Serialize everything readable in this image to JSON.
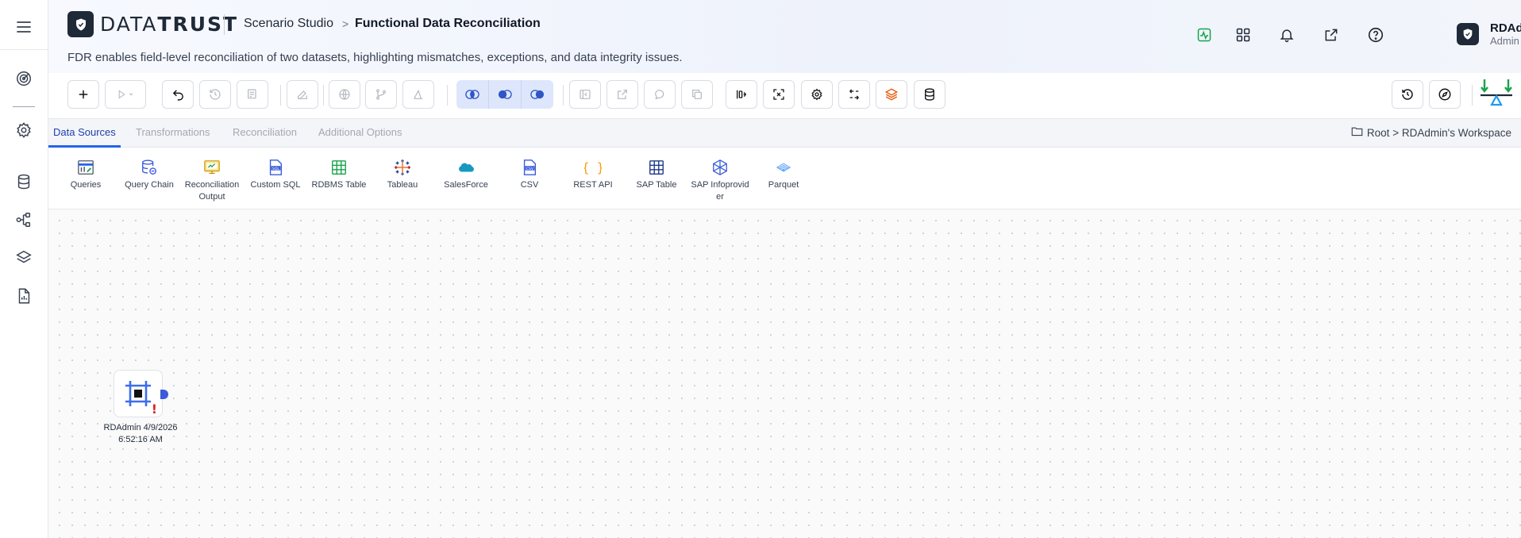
{
  "app": {
    "brand_light": "DATA",
    "brand_bold": "TRUST"
  },
  "header": {
    "breadcrumb_parent": "Scenario Studio",
    "breadcrumb_current": "Functional Data Reconciliation",
    "description": "FDR enables field-level reconciliation of two datasets, highlighting mismatches, exceptions, and data integrity issues."
  },
  "user": {
    "name": "RDAdmin",
    "role": "Admin"
  },
  "header_icons": [
    "activity-icon",
    "apps-grid-icon",
    "bell-icon",
    "external-link-icon",
    "help-icon"
  ],
  "rail_icons": [
    "target-icon",
    "settings-icon",
    "database-icon",
    "workflow-icon",
    "layers-icon",
    "report-icon"
  ],
  "tabs": [
    {
      "label": "Data Sources",
      "active": true
    },
    {
      "label": "Transformations",
      "active": false
    },
    {
      "label": "Reconciliation",
      "active": false
    },
    {
      "label": "Additional Options",
      "active": false
    }
  ],
  "workspace": {
    "root": "Root",
    "separator": ">",
    "name": "RDAdmin's Workspace"
  },
  "palette": [
    {
      "label": "Queries",
      "icon": "queries-icon"
    },
    {
      "label": "Query Chain",
      "icon": "query-chain-icon"
    },
    {
      "label": "Reconciliation Output",
      "icon": "reconciliation-output-icon"
    },
    {
      "label": "Custom SQL",
      "icon": "custom-sql-icon"
    },
    {
      "label": "RDBMS Table",
      "icon": "rdbms-table-icon"
    },
    {
      "label": "Tableau",
      "icon": "tableau-icon"
    },
    {
      "label": "SalesForce",
      "icon": "salesforce-icon"
    },
    {
      "label": "CSV",
      "icon": "csv-icon"
    },
    {
      "label": "REST API",
      "icon": "rest-api-icon"
    },
    {
      "label": "SAP Table",
      "icon": "sap-table-icon"
    },
    {
      "label": "SAP Infoprovider",
      "icon": "sap-infoprovider-icon"
    },
    {
      "label": "Parquet",
      "icon": "parquet-icon"
    }
  ],
  "canvas": {
    "node": {
      "label": "RDAdmin 4/9/2026 6:52:16 AM",
      "icon": "frame-node-icon",
      "warning": "!"
    }
  },
  "colors": {
    "accent": "#2563eb",
    "warning": "#dc2626",
    "brand_dark": "#1f2937",
    "success": "#16a34a"
  }
}
